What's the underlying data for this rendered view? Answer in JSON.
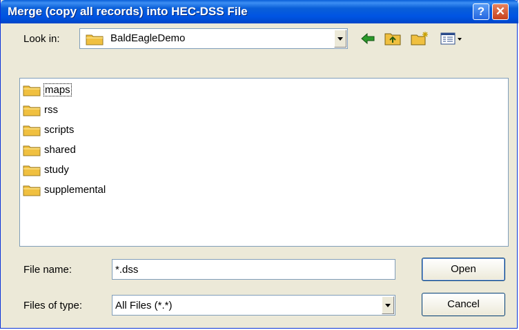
{
  "window": {
    "title": "Merge (copy all records) into HEC-DSS File"
  },
  "titlebar": {
    "help_glyph": "?",
    "close_glyph": "✕"
  },
  "look_in": {
    "label": "Look in:",
    "value": "BaldEagleDemo"
  },
  "toolbar": {
    "icons": [
      "back-arrow-icon",
      "up-folder-icon",
      "new-folder-icon",
      "view-menu-icon"
    ]
  },
  "files": [
    {
      "name": "maps"
    },
    {
      "name": "rss"
    },
    {
      "name": "scripts"
    },
    {
      "name": "shared"
    },
    {
      "name": "study"
    },
    {
      "name": "supplemental"
    }
  ],
  "file_name": {
    "label": "File name:",
    "value": "*.dss"
  },
  "file_type": {
    "label": "Files of type:",
    "value": "All Files (*.*)"
  },
  "buttons": {
    "open": "Open",
    "cancel": "Cancel"
  },
  "colors": {
    "titlebar": "#0054e3",
    "dialog_bg": "#ece9d8",
    "close_button": "#c7401c",
    "folder": "#f0c040"
  }
}
